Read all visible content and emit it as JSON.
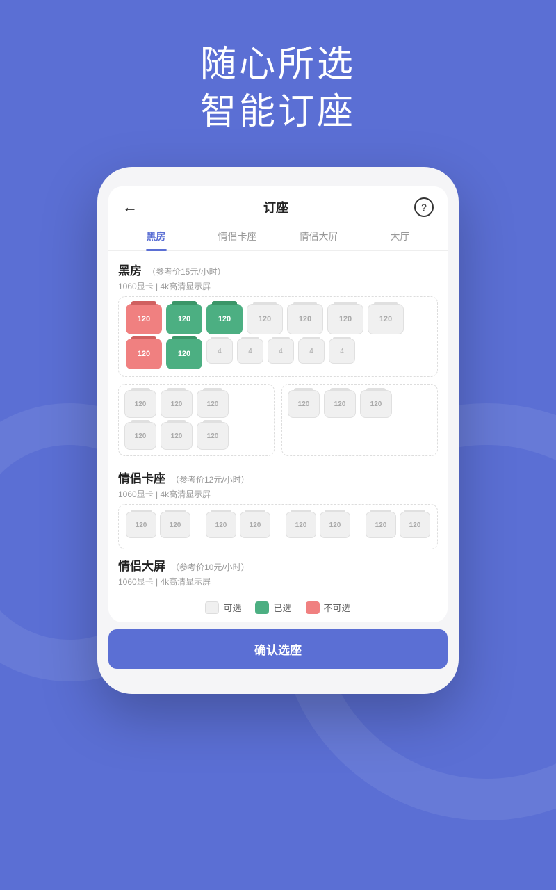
{
  "header": {
    "line1": "随心所选",
    "line2": "智能订座"
  },
  "nav": {
    "title": "订座",
    "back_icon": "←",
    "help_icon": "?"
  },
  "tabs": [
    {
      "label": "黑房",
      "active": true
    },
    {
      "label": "情侣卡座",
      "active": false
    },
    {
      "label": "情侣大屏",
      "active": false
    },
    {
      "label": "大厅",
      "active": false
    }
  ],
  "sections": [
    {
      "id": "heifang",
      "title": "黑房",
      "price": "（参考价15元/小时）",
      "subtitle": "1060显卡  |  4k高清显示屏"
    },
    {
      "id": "couple_card",
      "title": "情侣卡座",
      "price": "（参考价12元/小时）",
      "subtitle": "1060显卡  |  4k高清显示屏"
    },
    {
      "id": "couple_big",
      "title": "情侣大屏",
      "price": "（参考价10元/小时）",
      "subtitle": "1060显卡  |  4k高清显示屏"
    }
  ],
  "legend": {
    "available": "可选",
    "selected": "已选",
    "unavailable": "不可选"
  },
  "confirm_btn": "确认选座",
  "seats": {
    "row1": [
      "unavailable",
      "selected",
      "selected",
      "available",
      "available",
      "available",
      "available"
    ],
    "row2": [
      "unavailable",
      "selected",
      "num4",
      "num4",
      "num4",
      "num4",
      "num4"
    ]
  }
}
